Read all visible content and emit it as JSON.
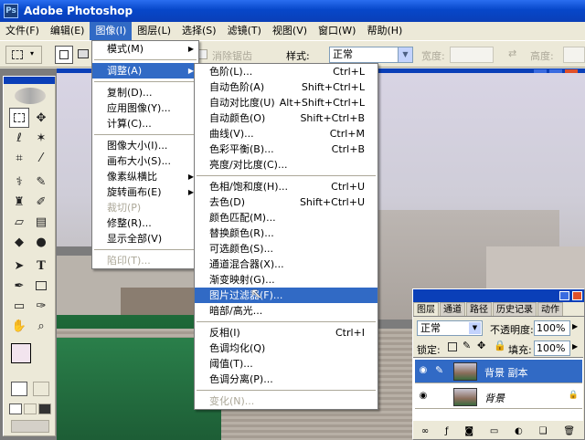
{
  "app": {
    "title": "Adobe Photoshop",
    "logo_text": "Ps"
  },
  "menubar": [
    "文件(F)",
    "编辑(E)",
    "图像(I)",
    "图层(L)",
    "选择(S)",
    "滤镜(T)",
    "视图(V)",
    "窗口(W)",
    "帮助(H)"
  ],
  "options": {
    "antialias": "消除锯齿",
    "style_label": "样式:",
    "style_value": "正常",
    "width_label": "宽度:",
    "height_label": "高度:"
  },
  "image_menu": [
    {
      "label": "模式(M)",
      "sub": true
    },
    {
      "sep": true
    },
    {
      "label": "调整(A)",
      "sub": true,
      "hl": true
    },
    {
      "sep": true
    },
    {
      "label": "复制(D)..."
    },
    {
      "label": "应用图像(Y)..."
    },
    {
      "label": "计算(C)..."
    },
    {
      "sep": true
    },
    {
      "label": "图像大小(I)..."
    },
    {
      "label": "画布大小(S)..."
    },
    {
      "label": "像素纵横比",
      "sub": true
    },
    {
      "label": "旋转画布(E)",
      "sub": true
    },
    {
      "label": "裁切(P)",
      "dis": true
    },
    {
      "label": "修整(R)..."
    },
    {
      "label": "显示全部(V)"
    },
    {
      "sep": true
    },
    {
      "label": "陷印(T)...",
      "dis": true
    }
  ],
  "adjust_menu": [
    {
      "label": "色阶(L)...",
      "sc": "Ctrl+L"
    },
    {
      "label": "自动色阶(A)",
      "sc": "Shift+Ctrl+L"
    },
    {
      "label": "自动对比度(U)",
      "sc": "Alt+Shift+Ctrl+L"
    },
    {
      "label": "自动颜色(O)",
      "sc": "Shift+Ctrl+B"
    },
    {
      "label": "曲线(V)...",
      "sc": "Ctrl+M"
    },
    {
      "label": "色彩平衡(B)...",
      "sc": "Ctrl+B"
    },
    {
      "label": "亮度/对比度(C)..."
    },
    {
      "sep": true
    },
    {
      "label": "色相/饱和度(H)...",
      "sc": "Ctrl+U"
    },
    {
      "label": "去色(D)",
      "sc": "Shift+Ctrl+U"
    },
    {
      "label": "颜色匹配(M)..."
    },
    {
      "label": "替换颜色(R)..."
    },
    {
      "label": "可选颜色(S)..."
    },
    {
      "label": "通道混合器(X)..."
    },
    {
      "label": "渐变映射(G)..."
    },
    {
      "label": "图片过滤器(F)...",
      "hl": true
    },
    {
      "label": "暗部/高光..."
    },
    {
      "sep": true
    },
    {
      "label": "反相(I)",
      "sc": "Ctrl+I"
    },
    {
      "label": "色调均化(Q)"
    },
    {
      "label": "阈值(T)..."
    },
    {
      "label": "色调分离(P)..."
    },
    {
      "sep": true
    },
    {
      "label": "变化(N)...",
      "dis": true
    }
  ],
  "layers_panel": {
    "tabs": [
      "图层",
      "通道",
      "路径",
      "历史记录",
      "动作"
    ],
    "blend_mode": "正常",
    "opacity_label": "不透明度:",
    "opacity": "100%",
    "lock_label": "锁定:",
    "fill_label": "填充:",
    "fill": "100%",
    "layers": [
      {
        "name": "背景 副本",
        "selected": true
      },
      {
        "name": "背景",
        "selected": false,
        "locked": true
      }
    ]
  }
}
